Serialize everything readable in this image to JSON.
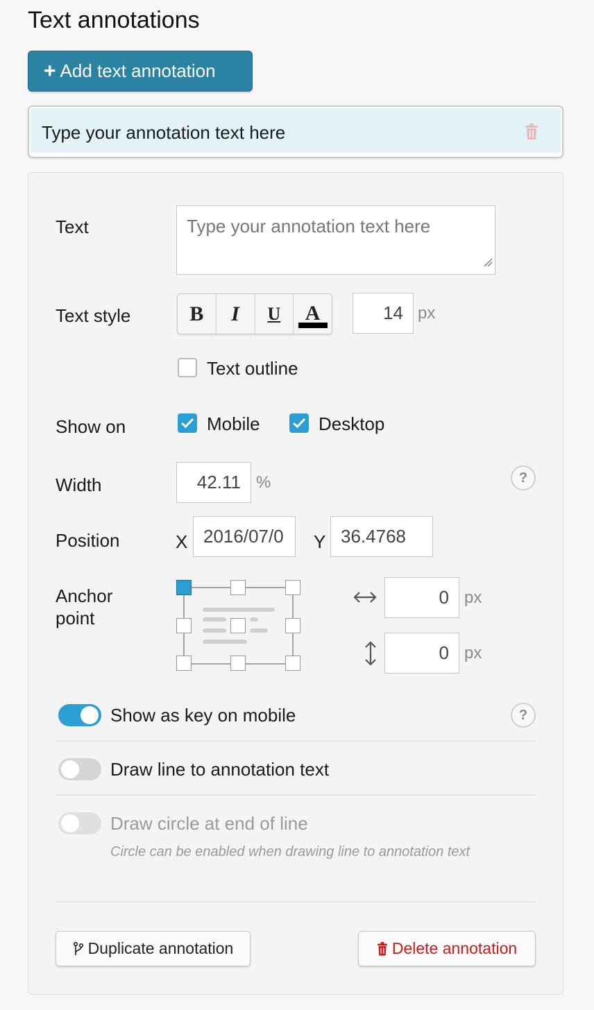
{
  "section_title": "Text annotations",
  "add_button_label": "Add text annotation",
  "annotation_item": {
    "label": "Type your annotation text here"
  },
  "form": {
    "text_label": "Text",
    "text_placeholder": "Type your annotation text here",
    "text_style_label": "Text style",
    "style_buttons": {
      "bold": "B",
      "italic": "I",
      "underline": "U",
      "color": "A",
      "color_value": "#000000"
    },
    "font_size": "14",
    "font_size_unit": "px",
    "text_outline_label": "Text outline",
    "text_outline_checked": false,
    "show_on_label": "Show on",
    "mobile_label": "Mobile",
    "mobile_checked": true,
    "desktop_label": "Desktop",
    "desktop_checked": true,
    "width_label": "Width",
    "width_value": "42.11",
    "width_unit": "%",
    "position_label": "Position",
    "x_label": "X",
    "x_value": "2016/07/0",
    "y_label": "Y",
    "y_value": "36.4768",
    "anchor_label_line1": "Anchor",
    "anchor_label_line2": "point",
    "anchor_selected": "top-left",
    "offset_x": "0",
    "offset_y": "0",
    "offset_unit": "px",
    "show_key_label": "Show as key on mobile",
    "show_key_on": true,
    "draw_line_label": "Draw line to annotation text",
    "draw_line_on": false,
    "draw_circle_label": "Draw circle at end of line",
    "draw_circle_on": false,
    "circle_hint": "Circle can be enabled when drawing line to annotation text",
    "help_symbol": "?"
  },
  "actions": {
    "duplicate_label": "Duplicate annotation",
    "delete_label": "Delete annotation"
  },
  "colors": {
    "accent": "#2b9fd3",
    "add_button": "#2a83a3",
    "selected_item_bg": "#e2f2f7",
    "delete_text": "#cc1b1b"
  }
}
